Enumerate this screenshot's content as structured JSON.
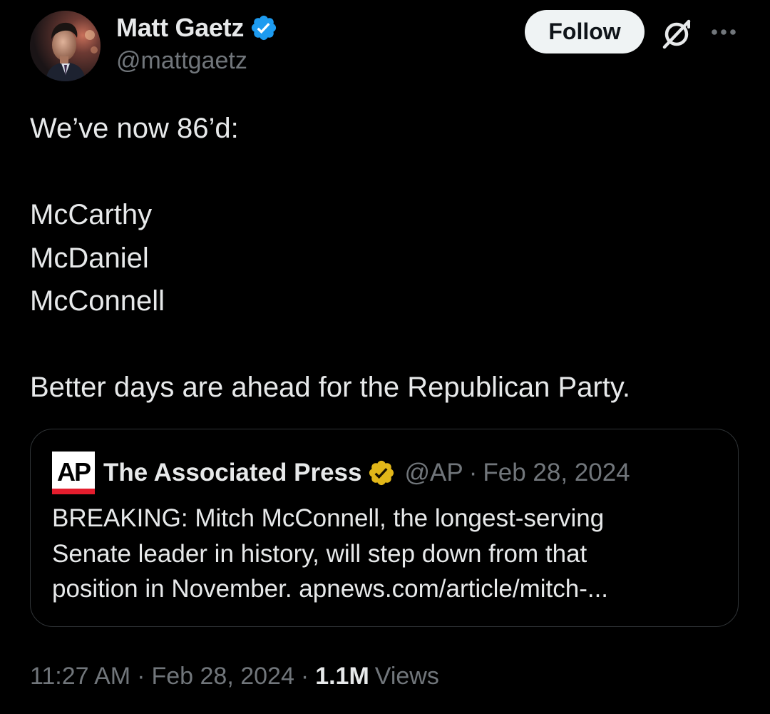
{
  "author": {
    "name": "Matt Gaetz",
    "handle": "@mattgaetz",
    "verified": true,
    "avatar_icon": "avatar-photo"
  },
  "header": {
    "follow_label": "Follow",
    "grok_icon": "grok-icon",
    "more_icon": "more-options-icon"
  },
  "tweet": {
    "lines": [
      "We’ve now 86’d:",
      "",
      "McCarthy",
      "McDaniel",
      "McConnell",
      "",
      "Better days are ahead for the Republican Party."
    ]
  },
  "quote": {
    "logo_text": "AP",
    "author": "The Associated Press",
    "handle": "@AP",
    "separator": "·",
    "date": "Feb 28, 2024",
    "lines": [
      "BREAKING: Mitch McConnell, the longest-serving",
      "Senate leader in history, will step down from that",
      "position in November.  apnews.com/article/mitch-..."
    ]
  },
  "footer": {
    "time": "11:27 AM",
    "separator": "·",
    "date": "Feb 28, 2024",
    "views_count": "1.1M",
    "views_label": "Views"
  },
  "colors": {
    "background": "#000000",
    "text_primary": "#e7e9ea",
    "text_secondary": "#71767b",
    "verified_blue": "#1d9bf0",
    "verified_gold": "#e2b719",
    "border": "#2f3336",
    "ap_red": "#e41d2d"
  }
}
